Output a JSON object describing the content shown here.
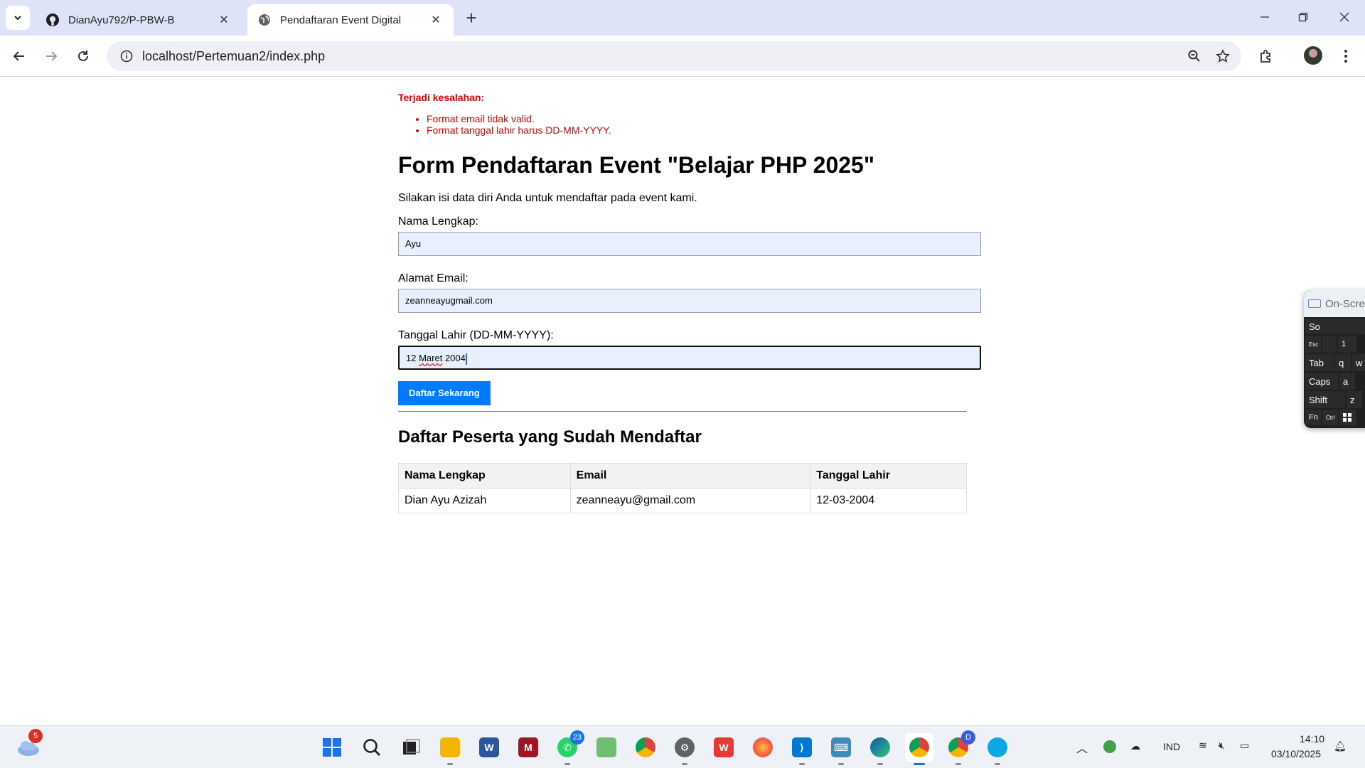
{
  "browser": {
    "tabs": [
      {
        "title": "DianAyu792/P-PBW-B",
        "icon": "github-icon",
        "active": false
      },
      {
        "title": "Pendaftaran Event Digital",
        "icon": "globe-icon",
        "active": true
      }
    ],
    "url": "localhost/Pertemuan2/index.php"
  },
  "page": {
    "errors": {
      "title": "Terjadi kesalahan:",
      "items": [
        "Format email tidak valid.",
        "Format tanggal lahir harus DD-MM-YYYY."
      ]
    },
    "title": "Form Pendaftaran Event \"Belajar PHP 2025\"",
    "intro": "Silakan isi data diri Anda untuk mendaftar pada event kami.",
    "form": {
      "name_label": "Nama Lengkap:",
      "name_value": "Ayu",
      "email_label": "Alamat Email:",
      "email_value": "zeanneayugmail.com",
      "birth_label": "Tanggal Lahir (DD-MM-YYYY):",
      "birth_value_day": "12",
      "birth_value_month": "Maret",
      "birth_value_year": "2004",
      "submit_label": "Daftar Sekarang"
    },
    "list": {
      "title": "Daftar Peserta yang Sudah Mendaftar",
      "columns": [
        "Nama Lengkap",
        "Email",
        "Tanggal Lahir"
      ],
      "rows": [
        [
          "Dian Ayu Azizah",
          "zeanneayu@gmail.com",
          "12-03-2004"
        ]
      ]
    }
  },
  "osk": {
    "title": "On-Scre",
    "keys": [
      "So",
      "Esc",
      "1",
      "Tab",
      "q",
      "w",
      "Caps",
      "a",
      "Shift",
      "z",
      "Fn",
      "Ctrl"
    ]
  },
  "taskbar": {
    "weather_badge": "5",
    "whatsapp_badge": "23",
    "chrome_profile_badge": "D",
    "language": "IND",
    "time": "14:10",
    "date": "03/10/2025"
  }
}
